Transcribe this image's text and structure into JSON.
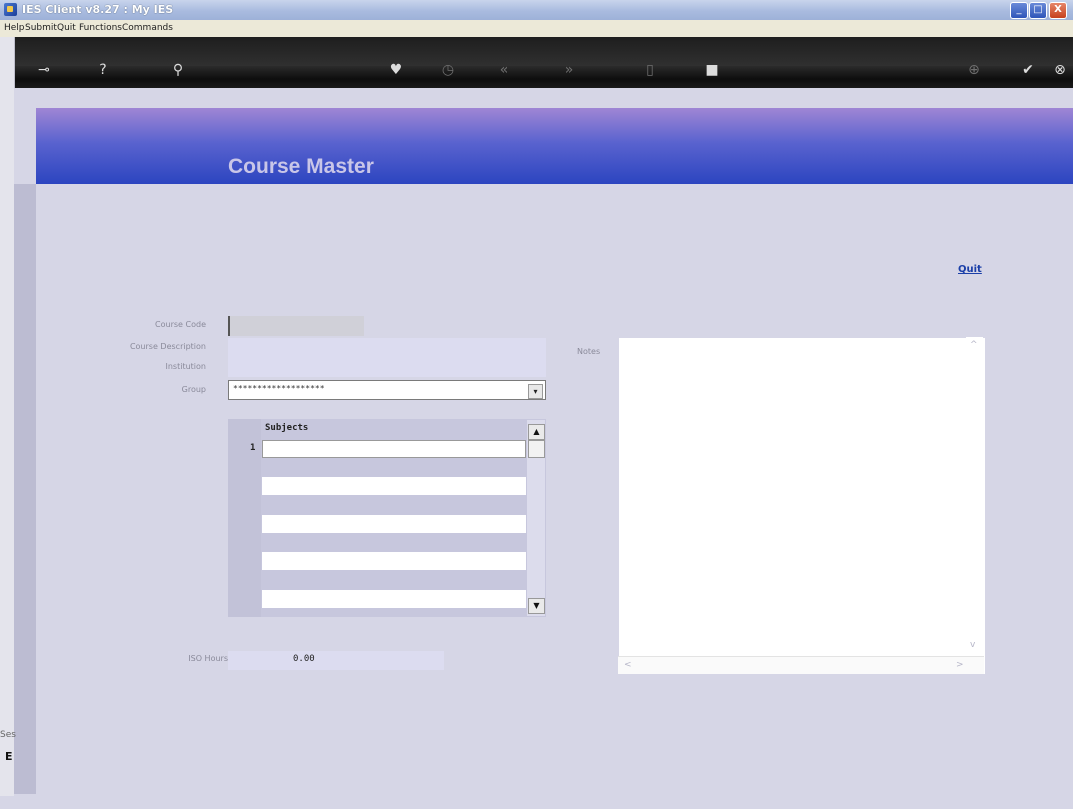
{
  "window": {
    "title": "IES Client v8.27 : My IES",
    "min_glyph": "_",
    "max_glyph": "□",
    "close_glyph": "X"
  },
  "menu": [
    "Help",
    "Submit",
    "Quit",
    "Functions",
    "Commands"
  ],
  "toolbar": {
    "icons": [
      "key-icon",
      "help-icon",
      "search-icon",
      "heart-icon",
      "history-icon",
      "back-icon",
      "forward-icon",
      "list-icon",
      "save-icon",
      "add-icon",
      "ok-icon",
      "close-icon"
    ],
    "glyphs": [
      "⊸",
      "?",
      "⚲",
      "♥",
      "◷",
      "«",
      "»",
      "▯",
      "■",
      "⊕",
      "✔",
      "⊗"
    ]
  },
  "banner": {
    "title": "Course Master"
  },
  "quit_link": "Quit",
  "form": {
    "course_code_label": "Course Code",
    "course_description_label": "Course Description",
    "institution_label": "Institution",
    "group_label": "Group",
    "group_value": "*******************",
    "dropdown_glyph": "▾",
    "notes_label": "Notes",
    "iso_hours_label": "ISO Hours",
    "iso_hours_value": "0.00"
  },
  "subjects": {
    "header": "Subjects",
    "first_row_number": "1",
    "rows": [
      "",
      "",
      "",
      "",
      "",
      ""
    ],
    "up_glyph": "▲",
    "down_glyph": "▼"
  },
  "notes_scroll": {
    "up": "^",
    "down": "v",
    "left": "<",
    "right": ">"
  },
  "bottom": {
    "ses": "Ses",
    "e": "E"
  }
}
